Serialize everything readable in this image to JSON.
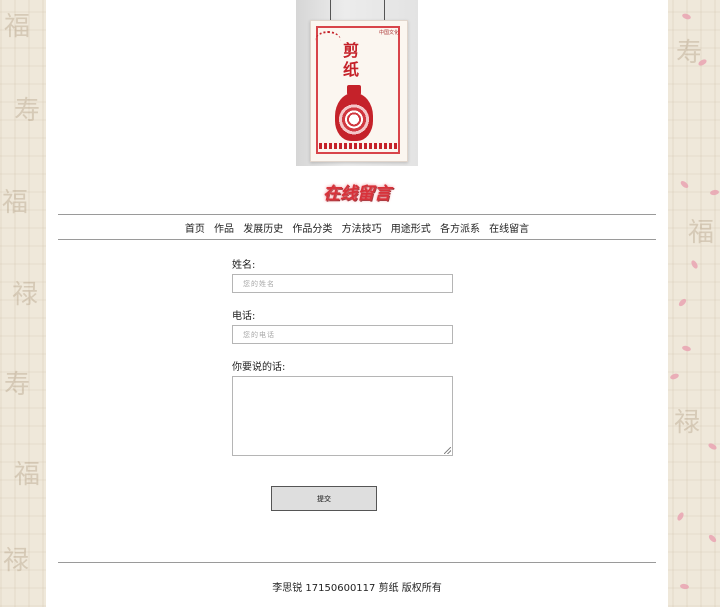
{
  "poster": {
    "small_text": "中国文化",
    "title_line1": "剪",
    "title_line2": "纸"
  },
  "page_heading": "在线留言",
  "nav": {
    "items": [
      "首页",
      "作品",
      "发展历史",
      "作品分类",
      "方法技巧",
      "用途形式",
      "各方派系",
      "在线留言"
    ]
  },
  "form": {
    "name_label": "姓名:",
    "name_placeholder": "您的姓名",
    "phone_label": "电话:",
    "phone_placeholder": "您的电话",
    "message_label": "你要说的话:",
    "submit_label": "提交"
  },
  "footer": {
    "text": "李思锐 17150600117 剪纸 版权所有"
  },
  "colors": {
    "heading_red": "#d8323a",
    "background": "#efe8da",
    "petal_pink": "#e9a3b1"
  }
}
